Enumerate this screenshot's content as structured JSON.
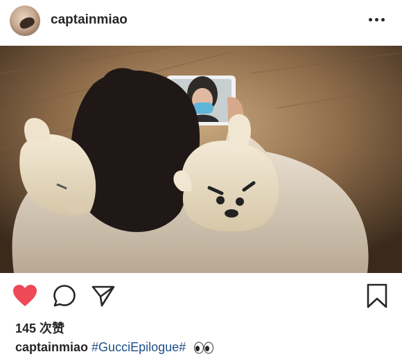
{
  "post": {
    "username": "captainmiao",
    "likes_text": "145 次赞",
    "caption": {
      "username": "captainmiao",
      "hashtag": "#GucciEpilogue#"
    }
  },
  "icons": {
    "avatar": "profile-photo",
    "more": "more-options-icon",
    "like": "heart-icon",
    "comment": "comment-icon",
    "share": "paper-plane-icon",
    "save": "bookmark-icon",
    "emoji": "eyes-emoji"
  },
  "colors": {
    "like_active": "#ed4956",
    "hashtag": "#1f4f8a",
    "text": "#262626"
  },
  "state": {
    "liked": true
  }
}
